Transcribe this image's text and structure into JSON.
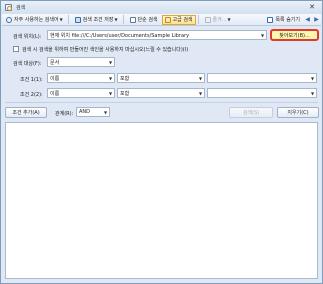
{
  "window": {
    "title": "검색",
    "close_glyph": "✕"
  },
  "toolbar": {
    "frequent_search": "자주 사용하는 검색어",
    "save_conditions": "검색 조건 저장",
    "simple_search": "단순 검색",
    "advanced_search": "고급 검색",
    "favorites": "즐겨...",
    "hide": "목록 숨기기",
    "back_glyph": "◀",
    "forward_glyph": "▶"
  },
  "form": {
    "location_label": "검색 위치(L):",
    "location_value": "현재 위치 file:///C:/Users/user/Documents/Sample Library",
    "browse_label": "찾아보기(B)...",
    "checkbox_label": "검색 시 검색을 위하여 만들어진 색인을 사용하지 마십시오(느릴 수 있습니다)(I)",
    "target_label": "검색 대상(F):",
    "target_value": "문서",
    "condition1_label": "조건 1(1):",
    "condition1_field": "이름",
    "condition1_op": "포함",
    "condition1_value": "",
    "condition2_label": "조건 2(2):",
    "condition2_field": "이름",
    "condition2_op": "포함",
    "condition2_value": "",
    "add_condition": "조건 추가(A)",
    "relation_label": "관계(R):",
    "relation_value": "AND",
    "search_button": "검색(S)",
    "clear_button": "지우기(C)"
  },
  "colors": {
    "highlight_border": "#e23b2b",
    "active_tab": "#ffe18a",
    "window_bg": "#dfe8f4"
  },
  "icons": {
    "app": "search-window-icon",
    "frequent": "search-icon",
    "save": "save-icon",
    "simple": "simple-search-icon",
    "advanced": "advanced-search-icon",
    "favorites": "favorites-icon",
    "hide": "hide-list-icon"
  }
}
